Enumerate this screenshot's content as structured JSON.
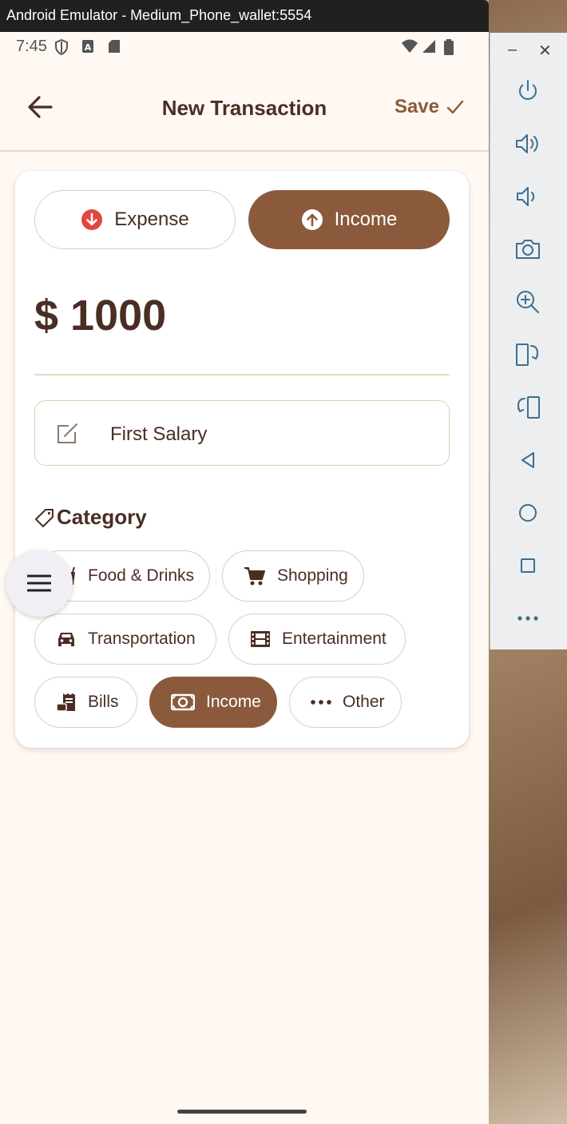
{
  "window": {
    "title": "Android Emulator - Medium_Phone_wallet:5554"
  },
  "status_bar": {
    "time": "7:45"
  },
  "app_bar": {
    "title": "New Transaction",
    "save_label": "Save"
  },
  "type_toggle": {
    "expense_label": "Expense",
    "income_label": "Income",
    "selected": "Income"
  },
  "amount": {
    "display": "$ 1000"
  },
  "note": {
    "value": "First Salary"
  },
  "category": {
    "header": "Category",
    "chips": [
      {
        "label": "Food & Drinks",
        "icon": "food-drink-icon",
        "selected": false
      },
      {
        "label": "Shopping",
        "icon": "shopping-cart-icon",
        "selected": false
      },
      {
        "label": "Transportation",
        "icon": "car-icon",
        "selected": false
      },
      {
        "label": "Entertainment",
        "icon": "film-icon",
        "selected": false
      },
      {
        "label": "Bills",
        "icon": "receipt-icon",
        "selected": false
      },
      {
        "label": "Income",
        "icon": "money-icon",
        "selected": true
      },
      {
        "label": "Other",
        "icon": "more-horizontal-icon",
        "selected": false
      }
    ]
  },
  "colors": {
    "primary": "#8b5a3c",
    "text": "#4a2e24",
    "background": "#fff8f3",
    "expense_accent": "#e0483e",
    "outline": "#e2cfb3"
  },
  "emulator_controls": [
    "power-icon",
    "volume-up-icon",
    "volume-down-icon",
    "camera-icon",
    "zoom-icon",
    "rotate-left-icon",
    "rotate-right-icon",
    "back-icon",
    "home-icon",
    "overview-icon",
    "more-icon"
  ]
}
